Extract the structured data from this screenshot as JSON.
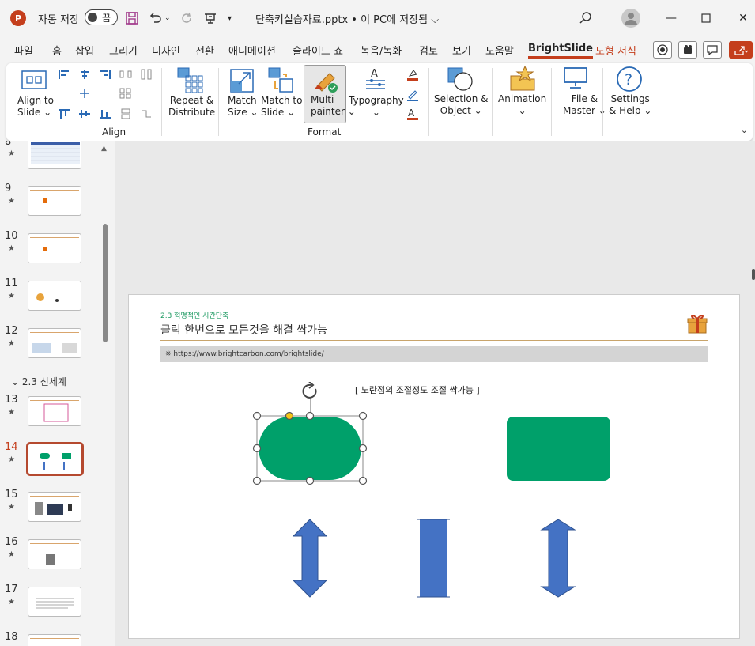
{
  "titlebar": {
    "app_letter": "P",
    "autosave_label": "자동 저장",
    "autosave_state": "끔",
    "doc_title": "단축키실습자료.pptx • 이 PC에 저장됨 ⌵"
  },
  "menu": {
    "tabs": [
      "파일",
      "홈",
      "삽입",
      "그리기",
      "디자인",
      "전환",
      "애니메이션",
      "슬라이드 쇼",
      "녹음/녹화",
      "검토",
      "보기",
      "도움말",
      "BrightSlide",
      "도형 서식"
    ]
  },
  "ribbon": {
    "align_to_slide": [
      "Align to",
      "Slide ⌄"
    ],
    "align_group": "Align",
    "repeat_distribute": [
      "Repeat &",
      "Distribute"
    ],
    "match_size": [
      "Match",
      "Size ⌄"
    ],
    "match_to_slide": [
      "Match to",
      "Slide ⌄"
    ],
    "multi_painter": [
      "Multi-",
      "painter ⌄"
    ],
    "typography": [
      "Typography",
      "⌄"
    ],
    "format_group": "Format",
    "selection_object": [
      "Selection &",
      "Object ⌄"
    ],
    "animation": [
      "Animation",
      "⌄"
    ],
    "file_master": [
      "File &",
      "Master ⌄"
    ],
    "settings_help": [
      "Settings",
      "& Help ⌄"
    ]
  },
  "thumbnails": {
    "section_title": "2.3 신세계",
    "slides": [
      {
        "num": "8"
      },
      {
        "num": "9"
      },
      {
        "num": "10"
      },
      {
        "num": "11"
      },
      {
        "num": "12"
      },
      {
        "num": "13"
      },
      {
        "num": "14"
      },
      {
        "num": "15"
      },
      {
        "num": "16"
      },
      {
        "num": "17"
      },
      {
        "num": "18"
      }
    ],
    "star": "★"
  },
  "slide": {
    "subtitle": "2.3 혁명적인 시간단축",
    "title": "클릭 한번으로 모든것을 해결 싹가능",
    "url": "※ https://www.brightcarbon.com/brightslide/",
    "note": "[ 노란점의 조절정도 조절 싹가능 ]",
    "shape_color": "#00a06a",
    "arrow_color": "#4472c4",
    "accent_color": "#c43e1c"
  }
}
